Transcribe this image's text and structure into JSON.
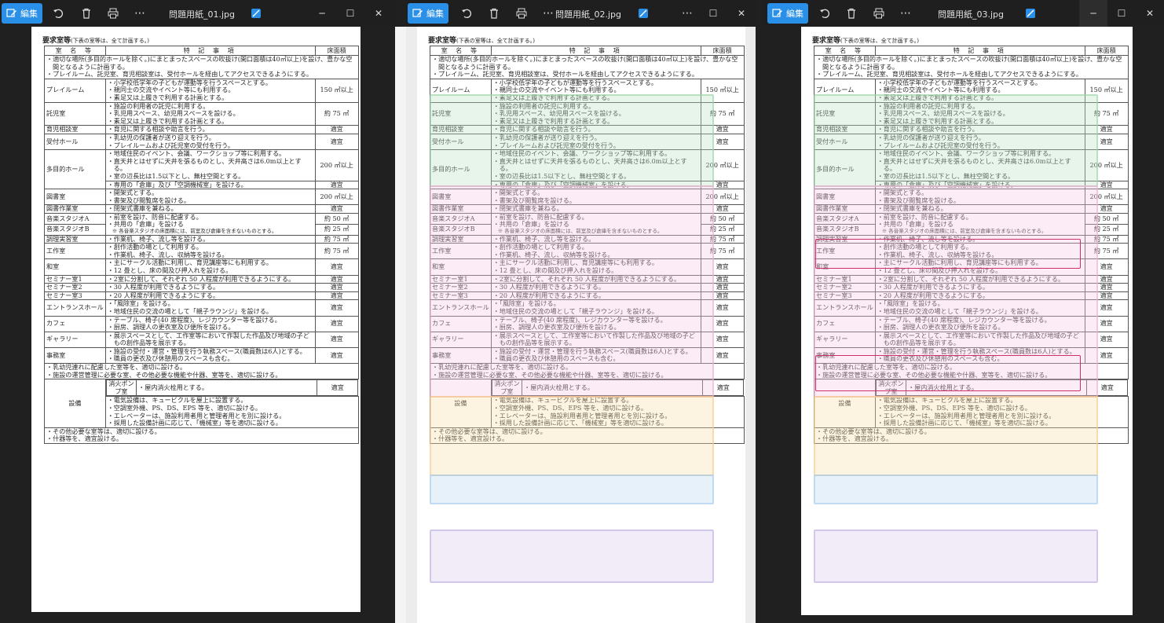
{
  "windows": [
    {
      "toolbar": {
        "edit_label": "編集"
      },
      "file_name": "問題用紙_01.jpg"
    },
    {
      "toolbar": {
        "edit_label": "編集"
      },
      "file_name": "問題用紙_02.jpg"
    },
    {
      "toolbar": {
        "edit_label": "編集"
      },
      "file_name": "問題用紙_03.jpg"
    }
  ],
  "sheet": {
    "title": "要求室等",
    "title_note": "(下表の室等は、全て計画する。)",
    "headers": [
      "室 名 等",
      "特 記 事 項",
      "床面積"
    ],
    "intro": [
      "・適切な場所(多目的ホールを除く。)にまとまったスペースの吹抜け(開口面積は40㎡以上)を設け、豊かな空間となるように計画する。",
      "・プレイルーム、託児室、育児相談室は、受付ホールを経由してアクセスできるようにする。"
    ],
    "rows": [
      {
        "name": "プレイルーム",
        "items": [
          "・小学校低学年の子どもが運動等を行うスペースとする。",
          "・親同士の交流やイベント等にも利用する。",
          "・素足又は上履きで利用する計画とする。"
        ],
        "area": "150 ㎡以上"
      },
      {
        "name": "託児室",
        "items": [
          "・施設の利用者の託児に利用する。",
          "・乳児用スペース、幼児用スペースを設ける。",
          "・素足又は上履きで利用する計画とする。"
        ],
        "area": "約 75 ㎡"
      },
      {
        "name": "育児相談室",
        "items": [
          "・育児に関する相談や助言を行う。"
        ],
        "area": "適宜"
      },
      {
        "name": "受付ホール",
        "items": [
          "・乳幼児の保護者が送り迎えを行う。",
          "・プレイルームおよび託児室の受付を行う。"
        ],
        "area": "適宜"
      },
      {
        "name": "多目的ホール",
        "items": [
          "・地域住民のイベント、会議、ワークショップ等に利用する。",
          "・直天井とはせずに天井を張るものとし、天井高さは6.0m以上とする。",
          "・室の辺長比は1.5以下とし、無柱空間とする。"
        ],
        "area": "200 ㎡以上"
      },
      {
        "name": "",
        "items": [
          "・専用の「倉庫」及び「空調機械室」を設ける。"
        ],
        "area": "適宜"
      },
      {
        "name": "図書室",
        "items": [
          "・開架式とする。",
          "・書架及び閲覧席を設ける。"
        ],
        "area": "200 ㎡以上"
      },
      {
        "name": "図書作業室",
        "items": [
          "・閉架式書庫を兼ねる。"
        ],
        "area": "適宜"
      },
      {
        "name": "音楽スタジオA",
        "items": [
          "・前室を設け、防音に配慮する。",
          "・共用の「倉庫」を設ける"
        ],
        "area": "約 50 ㎡"
      },
      {
        "name": "音楽スタジオB",
        "items": [],
        "note": "※ 各音楽スタジオの床面積には、前室及び倉庫を含まないものとする。",
        "area": "約 25 ㎡"
      },
      {
        "name": "調理実習室",
        "items": [
          "・作業机、椅子、流し等を設ける。"
        ],
        "area": "約 75 ㎡"
      },
      {
        "name": "工作室",
        "items": [
          "・創作活動の場として利用する。",
          "・作業机、椅子、流し、収納等を設ける。"
        ],
        "area": "約 75 ㎡"
      },
      {
        "name": "和室",
        "items": [
          "・主にサークル活動に利用し、育児講座等にも利用する。",
          "・12 畳とし、床の間及び押入れを設ける。"
        ],
        "area": "適宜"
      },
      {
        "name": "セミナー室1",
        "items": [
          "・2室に分割して、それぞれ 50 人程度が利用できるようにする。"
        ],
        "area": "適宜"
      },
      {
        "name": "セミナー室2",
        "items": [
          "・30 人程度が利用できるようにする。"
        ],
        "area": "適宜"
      },
      {
        "name": "セミナー室3",
        "items": [
          "・20 人程度が利用できるようにする。"
        ],
        "area": "適宜"
      },
      {
        "name": "エントランスホール",
        "items": [
          "・「風除室」を設ける。",
          "・地域住民の交流の場として「親子ラウンジ」を設ける。"
        ],
        "area": "適宜"
      },
      {
        "name": "カフェ",
        "items": [
          "・テーブル、椅子(40 席程度)、レジカウンター等を設ける。",
          "・厨房、調理人の更衣室及び便所を設ける。"
        ],
        "area": "適宜"
      },
      {
        "name": "ギャラリー",
        "items": [
          "・展示スペースとして、工作室等において作製した作品及び地域の子どもの創作品等を展示する。"
        ],
        "area": "適宜"
      },
      {
        "name": "事務室",
        "items": [
          "・施設の受付・運営・管理を行う執務スペース(職員数は6人)とする。",
          "・職員の更衣及び休憩用のスペースも含む。"
        ],
        "area": "適宜"
      }
    ],
    "notes_mid": [
      "・乳幼児連れに配慮した室等を、適切に設ける。",
      "・施設の運営管理に必要な室、その他必要な機能や什器、室等を、適切に設ける。"
    ],
    "equipment": {
      "label": "設備",
      "pump_name": "消火ポンプ室",
      "pump_item": "・屋内消火栓用とする。",
      "pump_area": "適宜",
      "items": [
        "・電気設備は、キュービクルを屋上に設置する。",
        "・空調室外機、PS、DS、EPS 等を、適切に設ける。",
        "・エレベーターは、施設利用者用と管理者用とを別に設ける。",
        "・採用した設備計画に応じて、「機械室」等を適切に設ける。"
      ]
    },
    "notes_end": [
      "・その他必要な室等は、適切に設ける。",
      "・什器等を、適宜設ける。"
    ]
  }
}
